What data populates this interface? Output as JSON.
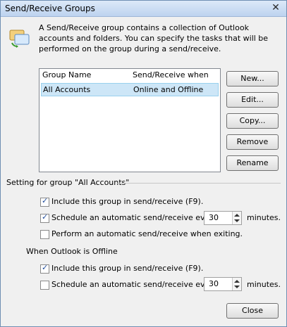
{
  "window": {
    "title": "Send/Receive Groups"
  },
  "intro": {
    "text": "A Send/Receive group contains a collection of Outlook accounts and folders. You can specify the tasks that will be performed on the group during a send/receive."
  },
  "list": {
    "headers": {
      "name": "Group Name",
      "when": "Send/Receive when"
    },
    "rows": [
      {
        "name": "All Accounts",
        "when": "Online and Offline",
        "selected": true
      }
    ]
  },
  "buttons": {
    "new": "New...",
    "edit": "Edit...",
    "copy": "Copy...",
    "remove": "Remove",
    "rename": "Rename",
    "close": "Close"
  },
  "setting": {
    "title": "Setting for group \"All Accounts\"",
    "online": {
      "include": {
        "label": "Include this group in send/receive (F9).",
        "checked": true
      },
      "schedule": {
        "label": "Schedule an automatic send/receive every",
        "checked": true,
        "value": "30",
        "unit": "minutes."
      },
      "exit": {
        "label": "Perform an automatic send/receive when exiting.",
        "checked": false
      }
    },
    "offline": {
      "title": "When Outlook is Offline",
      "include": {
        "label": "Include this group in send/receive (F9).",
        "checked": true
      },
      "schedule": {
        "label": "Schedule an automatic send/receive every",
        "checked": false,
        "value": "30",
        "unit": "minutes."
      }
    }
  },
  "icons": {
    "info": "send-receive-groups-icon",
    "close": "close-icon"
  }
}
